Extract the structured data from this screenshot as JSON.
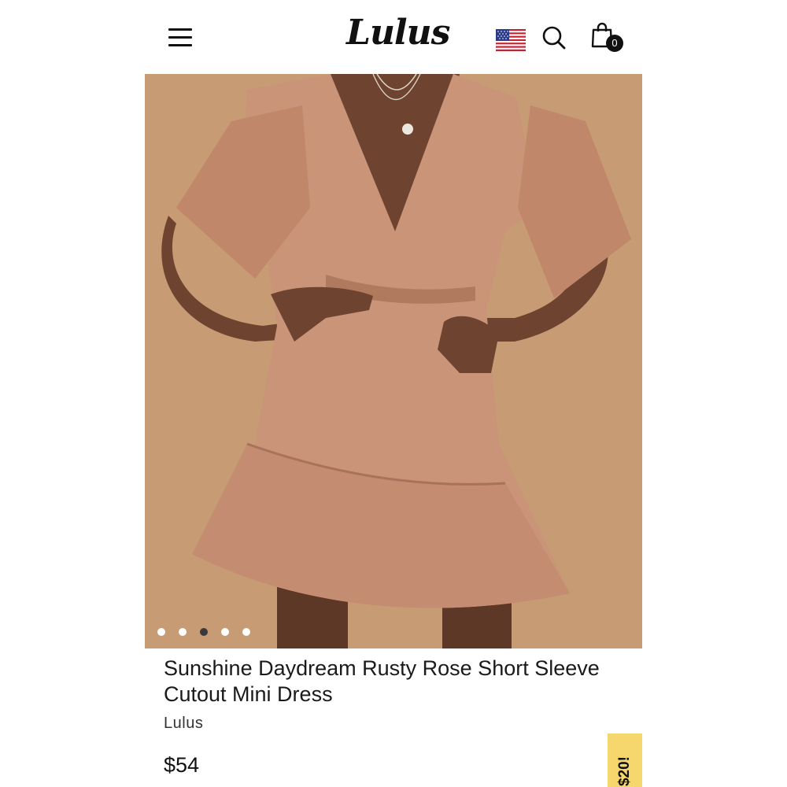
{
  "header": {
    "logo_text": "Lulus",
    "menu_icon": "hamburger-menu-icon",
    "flag_icon": "us-flag-icon",
    "search_icon": "search-icon",
    "cart_icon": "shopping-bag-icon",
    "cart_count": "0"
  },
  "product": {
    "image_description_icon": "dress-photo",
    "carousel": {
      "count": 5,
      "active_index": 2
    },
    "title": "Sunshine Daydream Rusty Rose Short Sleeve Cutout Mini Dress",
    "brand": "Lulus",
    "price": "$54"
  },
  "promo": {
    "label": "$20!",
    "color": "#f5d76e"
  },
  "colors": {
    "dress": "#c99478",
    "background": "#c79c74",
    "skin": "#6e4330"
  }
}
